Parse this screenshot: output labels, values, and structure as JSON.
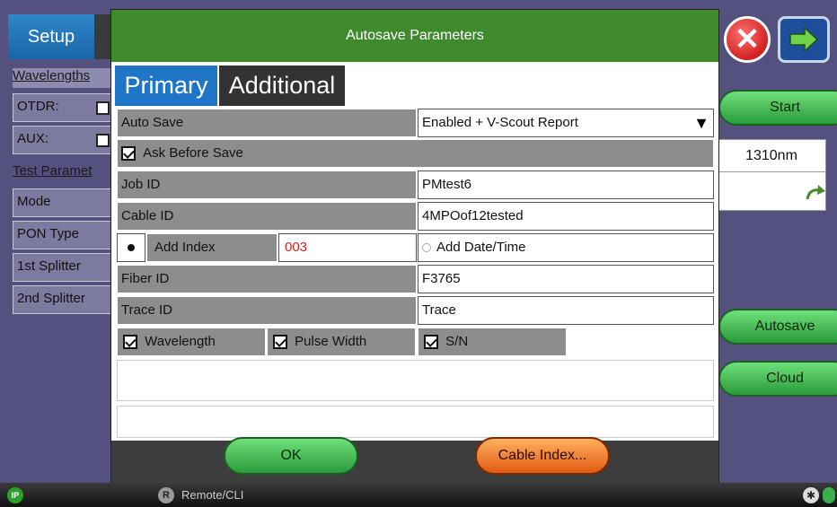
{
  "background": {
    "setup_tab": "Setup",
    "wavelengths_label": "Wavelengths",
    "otdr_label": "OTDR:",
    "aux_label": "AUX:",
    "test_params_label": "Test Paramet",
    "left_items": [
      "Mode",
      "PON Type",
      "1st Splitter",
      "2nd Splitter"
    ],
    "start_button": "Start",
    "wavelength_value": "1310nm",
    "autosave_button": "Autosave",
    "cloud_button": "Cloud",
    "status_remote": "Remote/CLI"
  },
  "dialog": {
    "title": "Autosave Parameters",
    "tabs": {
      "primary": "Primary",
      "additional": "Additional"
    },
    "auto_save": {
      "label": "Auto Save",
      "value": "Enabled + V-Scout Report"
    },
    "ask_before_save": {
      "label": "Ask Before Save",
      "checked": true
    },
    "job_id": {
      "label": "Job ID",
      "value": "PMtest6"
    },
    "cable_id": {
      "label": "Cable ID",
      "value": "4MPOof12tested"
    },
    "add_index": {
      "label": "Add Index",
      "value": "003",
      "selected": true
    },
    "add_datetime": {
      "label": "Add Date/Time",
      "selected": false
    },
    "fiber_id": {
      "label": "Fiber ID",
      "value": "F3765"
    },
    "trace_id": {
      "label": "Trace ID",
      "value": "Trace"
    },
    "options": {
      "wavelength": "Wavelength",
      "pulse_width": "Pulse Width",
      "sn": "S/N"
    },
    "ok_button": "OK",
    "cable_index_button": "Cable Index..."
  }
}
